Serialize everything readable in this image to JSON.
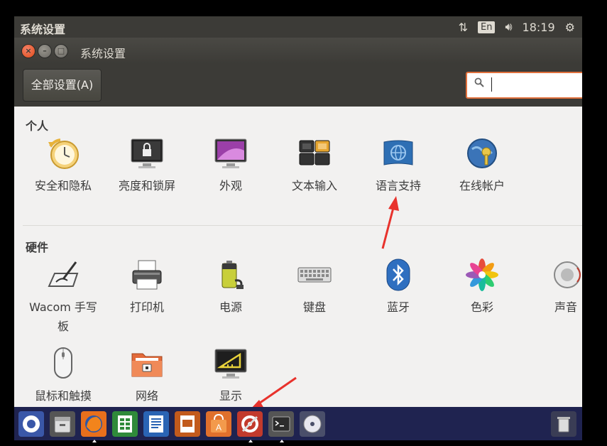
{
  "panel": {
    "title": "系统设置",
    "keyboard_layout": "En",
    "time": "18:19"
  },
  "window": {
    "title": "系统设置",
    "all_settings_label": "全部设置(A)",
    "search": {
      "value": "",
      "placeholder": ""
    }
  },
  "sections": [
    {
      "title": "个人",
      "items": [
        {
          "label": "安全和隐私",
          "icon": "security-privacy-icon"
        },
        {
          "label": "亮度和锁屏",
          "icon": "brightness-lock-icon"
        },
        {
          "label": "外观",
          "icon": "appearance-icon"
        },
        {
          "label": "文本输入",
          "icon": "text-entry-icon"
        },
        {
          "label": "语言支持",
          "icon": "language-support-icon"
        },
        {
          "label": "在线帐户",
          "icon": "online-accounts-icon"
        }
      ]
    },
    {
      "title": "硬件",
      "items": [
        {
          "label": "Wacom 手写板",
          "icon": "wacom-tablet-icon"
        },
        {
          "label": "打印机",
          "icon": "printer-icon"
        },
        {
          "label": "电源",
          "icon": "power-icon"
        },
        {
          "label": "键盘",
          "icon": "keyboard-icon"
        },
        {
          "label": "蓝牙",
          "icon": "bluetooth-icon"
        },
        {
          "label": "色彩",
          "icon": "color-icon"
        },
        {
          "label": "声音",
          "icon": "sound-icon"
        },
        {
          "label": "鼠标和触摸",
          "icon": "mouse-touchpad-icon"
        },
        {
          "label": "网络",
          "icon": "network-icon"
        },
        {
          "label": "显示",
          "icon": "display-icon"
        }
      ]
    }
  ],
  "launcher": [
    "dash-icon",
    "files-icon",
    "firefox-icon",
    "libreoffice-calc-icon",
    "libreoffice-writer-icon",
    "libreoffice-impress-icon",
    "software-center-icon",
    "system-settings-icon",
    "terminal-icon",
    "dvd-icon",
    "trash-icon"
  ],
  "colors": {
    "panel_bg": "#3c3b37",
    "window_bg": "#f2f1f0",
    "accent": "#e0703c",
    "launcher_bg": "#1f2350",
    "annotation_arrow": "#e8322c"
  }
}
